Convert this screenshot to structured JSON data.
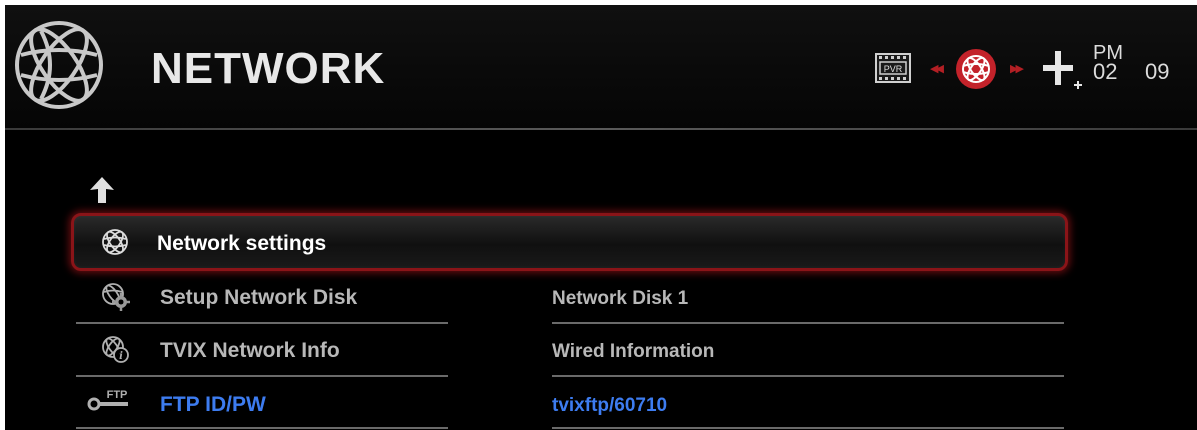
{
  "header": {
    "title": "NETWORK",
    "icons": [
      "globe-icon",
      "pvr-icon",
      "prev-icon",
      "globe-red-icon",
      "next-icon",
      "plus-icon"
    ],
    "pvr_label": "PVR",
    "clock": {
      "ampm": "PM",
      "hour": "02",
      "minute": "09"
    }
  },
  "menu": {
    "up_icon": "up-arrow-icon",
    "items": [
      {
        "label": "Network settings",
        "icon": "globe-icon",
        "value": "",
        "selected": true
      },
      {
        "label": "Setup Network Disk",
        "icon": "network-disk-gear-icon",
        "value": "Network Disk 1"
      },
      {
        "label": "TVIX Network Info",
        "icon": "network-info-icon",
        "value": "Wired Information"
      },
      {
        "label": "FTP ID/PW",
        "icon": "ftp-key-icon",
        "icon_text": "FTP",
        "value": "tvixftp/60710"
      }
    ]
  },
  "colors": {
    "background": "#000000",
    "accent_red": "#b31f24",
    "selected_text": "#ffffff",
    "item_text": "#b8b8b8",
    "link_blue": "#3d7cf0"
  }
}
